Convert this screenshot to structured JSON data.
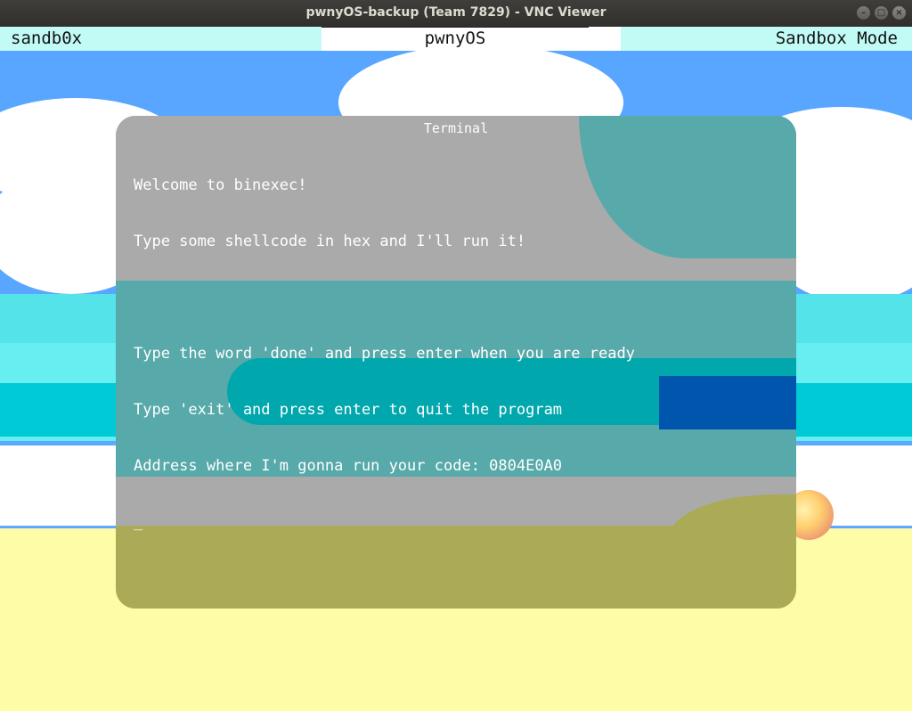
{
  "window": {
    "title": "pwnyOS-backup (Team 7829) - VNC Viewer"
  },
  "topbar": {
    "left": "sandb0x",
    "center": "pwnyOS",
    "right": "Sandbox Mode"
  },
  "terminal": {
    "title": "Terminal",
    "lines": [
      "Welcome to binexec!",
      "Type some shellcode in hex and I'll run it!",
      "",
      "Type the word 'done' and press enter when you are ready",
      "Type 'exit' and press enter to quit the program",
      "Address where I'm gonna run your code: 0804E0A0",
      "_"
    ]
  }
}
